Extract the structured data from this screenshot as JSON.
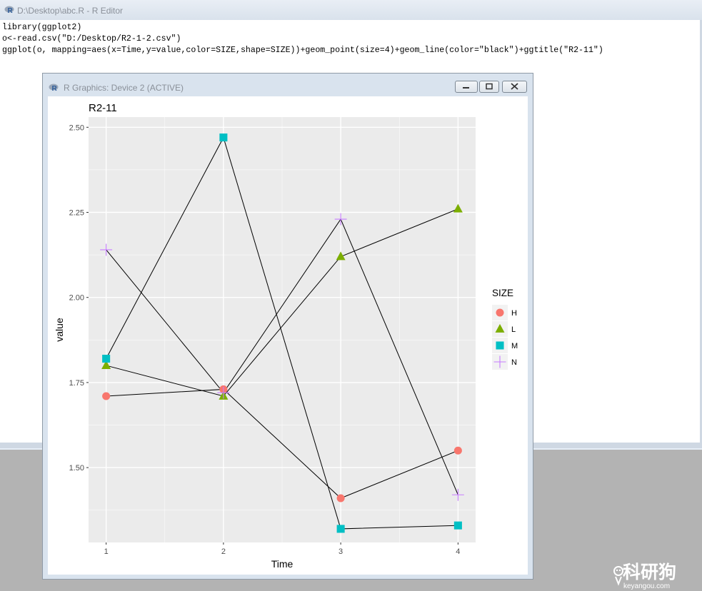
{
  "editor": {
    "title": "D:\\Desktop\\abc.R - R Editor",
    "code_lines": [
      "library(ggplot2)",
      "o<-read.csv(\"D:/Desktop/R2-1-2.csv\")",
      "ggplot(o, mapping=aes(x=Time,y=value,color=SIZE,shape=SIZE))+geom_point(size=4)+geom_line(color=\"black\")+ggtitle(\"R2-11\")"
    ]
  },
  "device": {
    "title": "R Graphics: Device 2 (ACTIVE)",
    "buttons": {
      "minimize": "minimize",
      "maximize": "maximize",
      "close": "close"
    }
  },
  "chart_data": {
    "type": "scatter",
    "title": "R2-11",
    "xlabel": "Time",
    "ylabel": "value",
    "x": [
      1,
      2,
      3,
      4
    ],
    "xlim": [
      0.85,
      4.15
    ],
    "ylim": [
      1.28,
      2.53
    ],
    "yticks": [
      1.5,
      1.75,
      2.0,
      2.25,
      2.5
    ],
    "ytick_labels": [
      "1.50",
      "1.75",
      "2.00",
      "2.25",
      "2.50"
    ],
    "xtick_labels": [
      "1",
      "2",
      "3",
      "4"
    ],
    "grid": true,
    "background": "#ebebeb",
    "legend": {
      "title": "SIZE",
      "position": "right"
    },
    "line_color": "#000000",
    "series": [
      {
        "name": "H",
        "shape": "circle",
        "color": "#F8766D",
        "values": [
          1.71,
          1.73,
          1.41,
          1.55
        ]
      },
      {
        "name": "L",
        "shape": "triangle",
        "color": "#7CAE00",
        "values": [
          1.8,
          1.71,
          2.12,
          2.26
        ]
      },
      {
        "name": "M",
        "shape": "square",
        "color": "#00BFC4",
        "values": [
          1.82,
          2.47,
          1.32,
          1.33
        ]
      },
      {
        "name": "N",
        "shape": "plus",
        "color": "#C77CFF",
        "values": [
          2.14,
          1.72,
          2.23,
          1.42
        ]
      }
    ]
  },
  "watermark": {
    "text": "科研狗",
    "subtext": "keyangou.com"
  }
}
